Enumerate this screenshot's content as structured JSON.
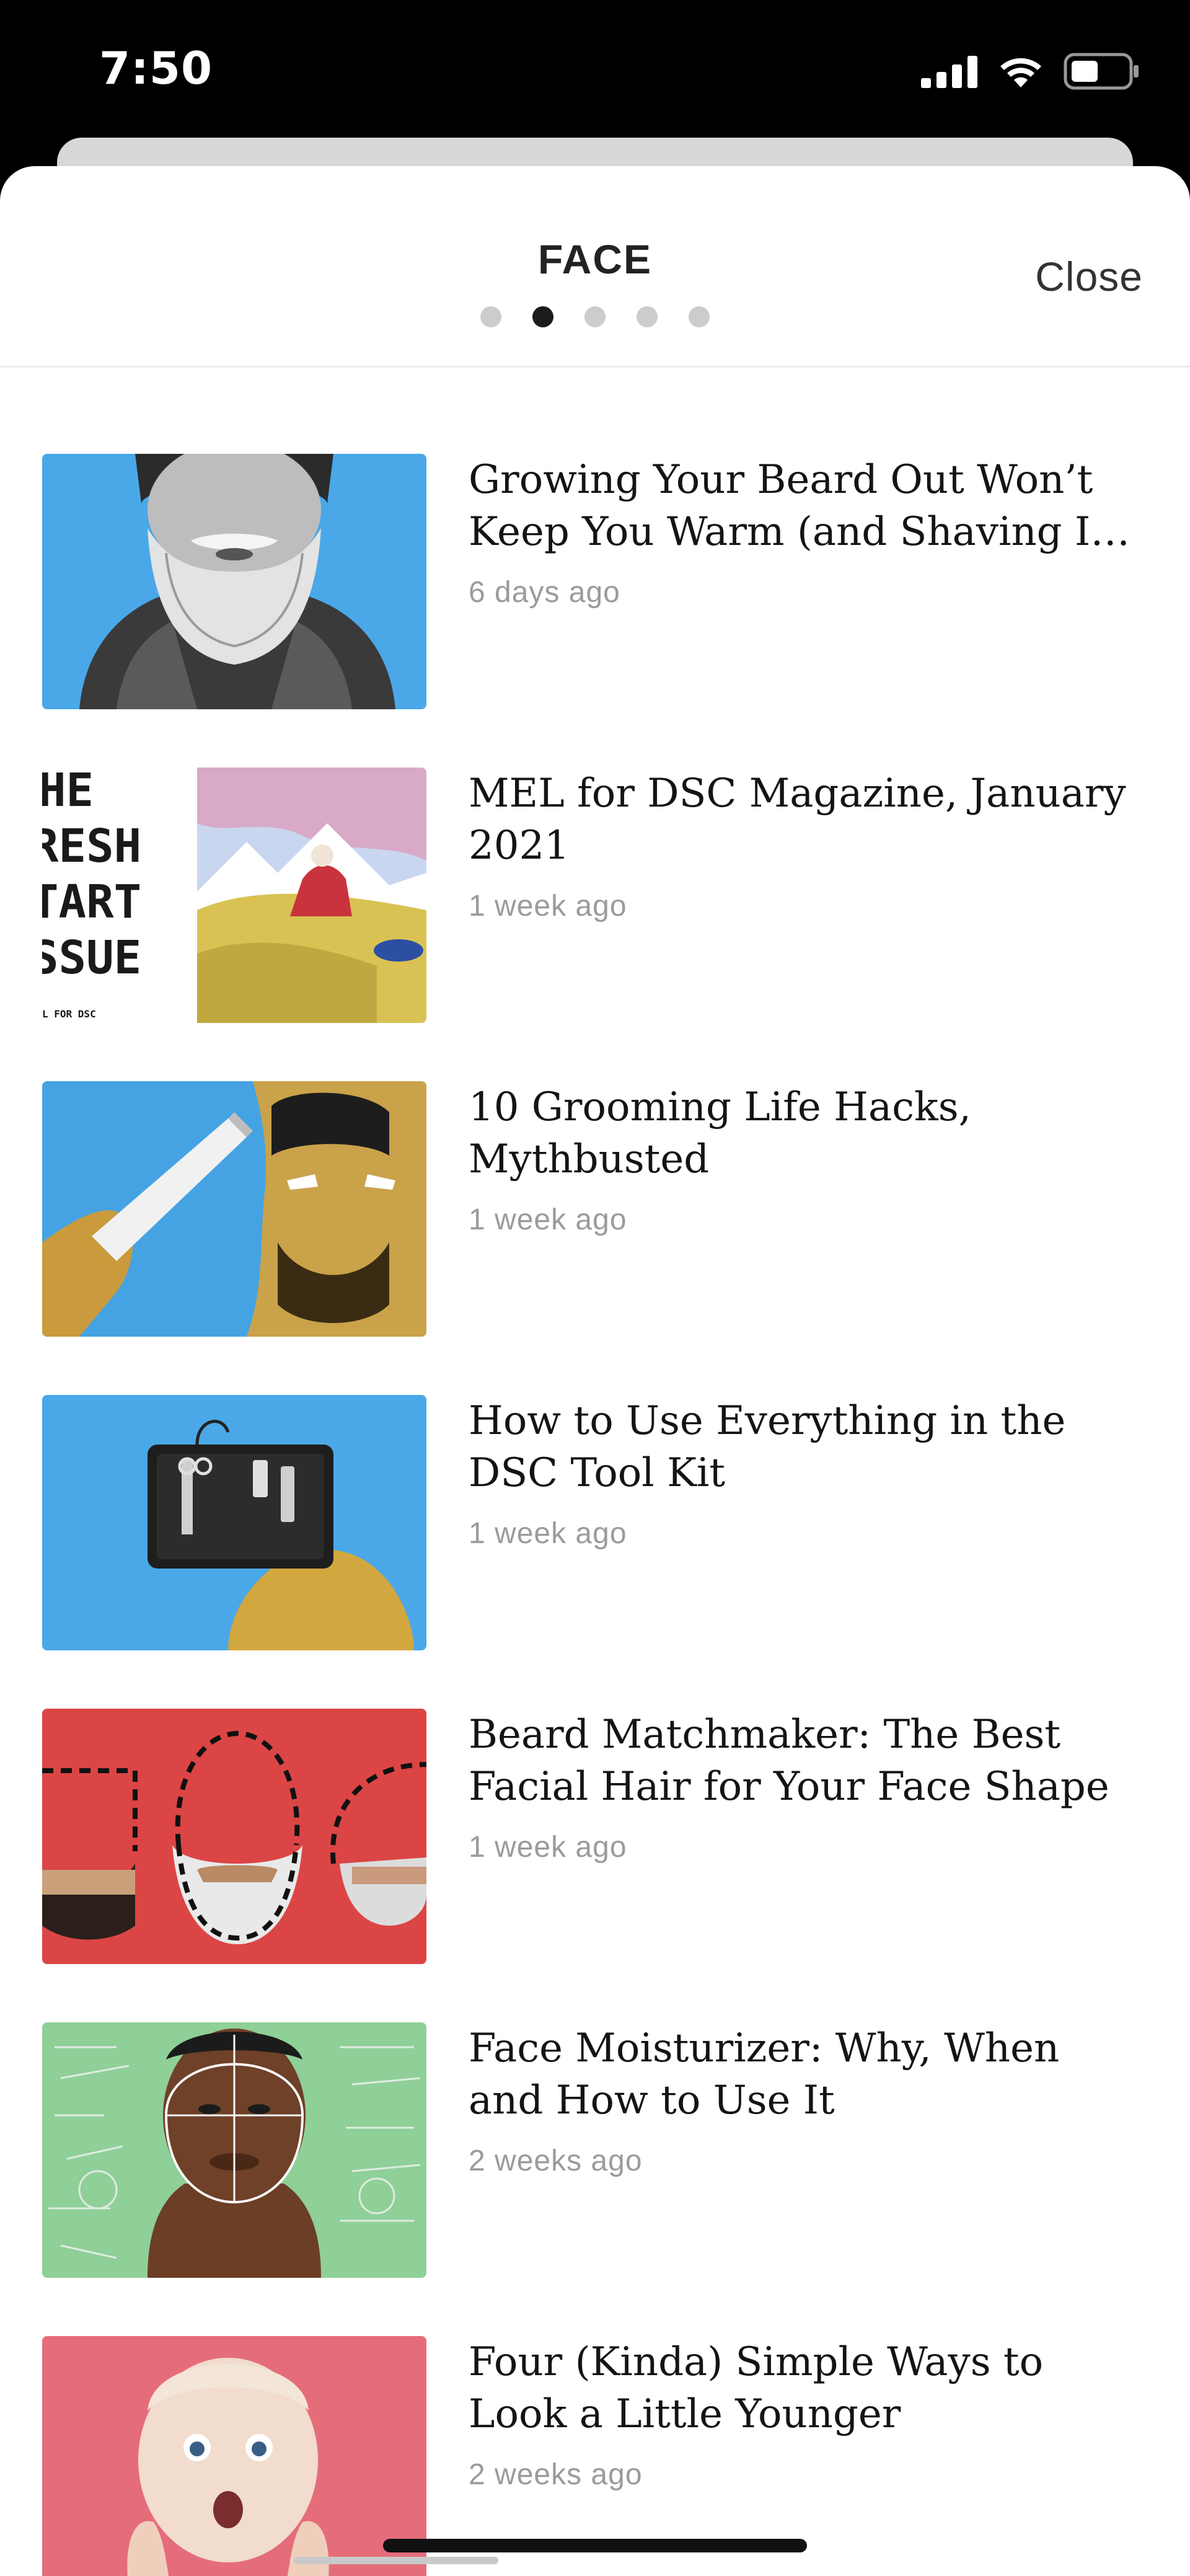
{
  "status_bar": {
    "time": "7:50",
    "icons": [
      "signal-icon",
      "wifi-icon",
      "battery-icon"
    ]
  },
  "header": {
    "title": "FACE",
    "close_label": "Close",
    "page_count": 5,
    "active_page": 2
  },
  "articles": [
    {
      "title": "Growing Your Beard Out Won’t Keep You Warm (and Shaving It o…",
      "time": "6 days ago",
      "thumb_bg": "#4aa8e8"
    },
    {
      "title": "MEL for DSC Magazine, January 2021",
      "time": "1 week ago",
      "thumb_bg": "#ffffff",
      "thumb_text": [
        "HE",
        "RESH",
        "TART",
        "SSUE",
        "L FOR DSC"
      ]
    },
    {
      "title": "10 Grooming Life Hacks, Mythbusted",
      "time": "1 week ago",
      "thumb_bg": "#45a3e3"
    },
    {
      "title": "How to Use Everything in the DSC Tool Kit",
      "time": "1 week ago",
      "thumb_bg": "#4aa8e8"
    },
    {
      "title": "Beard Matchmaker: The Best Facial Hair for Your Face Shape",
      "time": "1 week ago",
      "thumb_bg": "#dc4545"
    },
    {
      "title": "Face Moisturizer: Why, When and How to Use It",
      "time": "2 weeks ago",
      "thumb_bg": "#8fcf98"
    },
    {
      "title": "Four (Kinda) Simple Ways to Look a Little Younger",
      "time": "2 weeks ago",
      "thumb_bg": "#e56d7a"
    }
  ]
}
